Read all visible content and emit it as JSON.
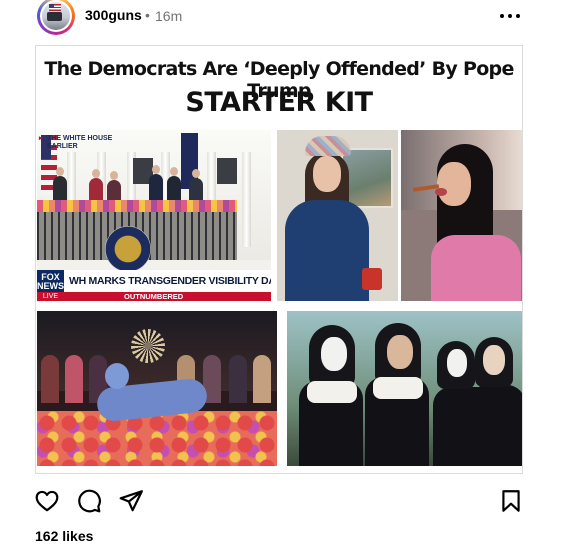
{
  "post": {
    "username": "300guns",
    "separator": "•",
    "timestamp": "16m",
    "likes": "162 likes"
  },
  "meme": {
    "title_line1": "The Democrats Are ‘Deeply Offended’  By Pope Trump",
    "title_line2": "STARTER KIT",
    "news": {
      "tag": "THE WHITE HOUSE\nEARLIER",
      "network": "FOX\nNEWS",
      "live": "LIVE",
      "headline": "WH MARKS TRANSGENDER VISIBILITY DAY ON EASTER",
      "show": "OUTNUMBERED"
    }
  },
  "icons": {
    "more": "more-horizontal-icon",
    "like": "heart-icon",
    "comment": "comment-icon",
    "share": "send-icon",
    "save": "bookmark-icon"
  },
  "colors": {
    "text_primary": "#000000",
    "text_secondary": "#737373",
    "border": "#dbdbdb",
    "fox_red": "#c8102e",
    "fox_blue": "#0b2a63"
  }
}
